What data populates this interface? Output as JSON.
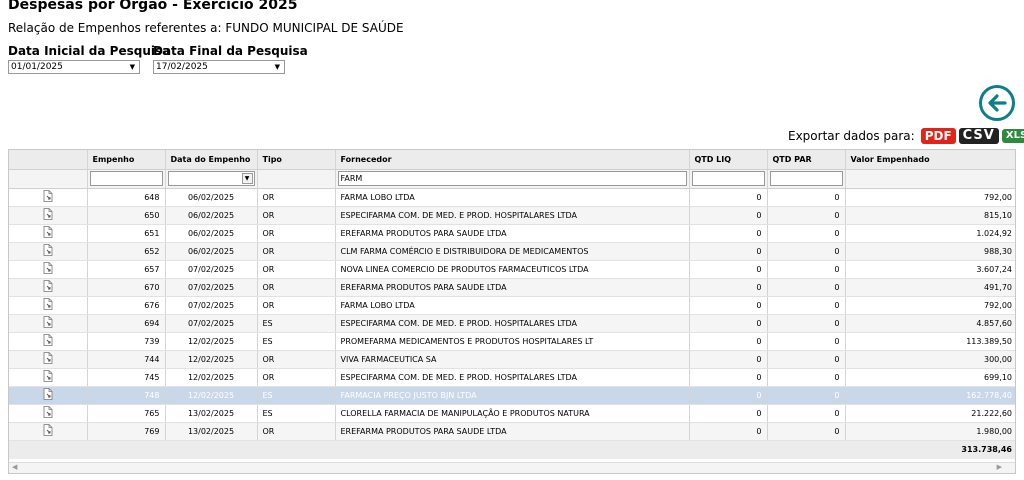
{
  "header": {
    "title": "Despesas por Orgão - Exercício 2025",
    "subtitle": "Relação de Empenhos referentes a: FUNDO MUNICIPAL DE SAÚDE"
  },
  "filters": {
    "start_label": "Data Inicial da Pesquisa",
    "start_value": "01/01/2025",
    "end_label": "Data Final da Pesquisa",
    "end_value": "17/02/2025"
  },
  "export": {
    "label": "Exportar dados para:",
    "pdf": "PDF",
    "csv": "CSV",
    "xls": "XLS"
  },
  "table": {
    "columns": [
      "",
      "Empenho",
      "Data do Empenho",
      "Tipo",
      "Fornecedor",
      "QTD LIQ",
      "QTD PAR",
      "Valor Empenhado"
    ],
    "filter_fornecedor": "FARM",
    "rows": [
      {
        "empenho": "648",
        "data": "06/02/2025",
        "tipo": "OR",
        "fornecedor": "FARMA LOBO LTDA",
        "qtd_liq": "0",
        "qtd_par": "0",
        "valor": "792,00"
      },
      {
        "empenho": "650",
        "data": "06/02/2025",
        "tipo": "OR",
        "fornecedor": "ESPECIFARMA COM. DE MED. E PROD. HOSPITALARES LTDA",
        "qtd_liq": "0",
        "qtd_par": "0",
        "valor": "815,10"
      },
      {
        "empenho": "651",
        "data": "06/02/2025",
        "tipo": "OR",
        "fornecedor": "EREFARMA PRODUTOS PARA SAUDE LTDA",
        "qtd_liq": "0",
        "qtd_par": "0",
        "valor": "1.024,92"
      },
      {
        "empenho": "652",
        "data": "06/02/2025",
        "tipo": "OR",
        "fornecedor": "CLM FARMA COMÉRCIO E DISTRIBUIDORA DE MEDICAMENTOS",
        "qtd_liq": "0",
        "qtd_par": "0",
        "valor": "988,30"
      },
      {
        "empenho": "657",
        "data": "07/02/2025",
        "tipo": "OR",
        "fornecedor": "NOVA LINEA COMERCIO DE PRODUTOS FARMACEUTICOS LTDA",
        "qtd_liq": "0",
        "qtd_par": "0",
        "valor": "3.607,24"
      },
      {
        "empenho": "670",
        "data": "07/02/2025",
        "tipo": "OR",
        "fornecedor": "EREFARMA PRODUTOS PARA SAUDE LTDA",
        "qtd_liq": "0",
        "qtd_par": "0",
        "valor": "491,70"
      },
      {
        "empenho": "676",
        "data": "07/02/2025",
        "tipo": "OR",
        "fornecedor": "FARMA LOBO LTDA",
        "qtd_liq": "0",
        "qtd_par": "0",
        "valor": "792,00"
      },
      {
        "empenho": "694",
        "data": "07/02/2025",
        "tipo": "ES",
        "fornecedor": "ESPECIFARMA COM. DE MED. E PROD. HOSPITALARES LTDA",
        "qtd_liq": "0",
        "qtd_par": "0",
        "valor": "4.857,60"
      },
      {
        "empenho": "739",
        "data": "12/02/2025",
        "tipo": "ES",
        "fornecedor": "PROMEFARMA MEDICAMENTOS E PRODUTOS HOSPITALARES LT",
        "qtd_liq": "0",
        "qtd_par": "0",
        "valor": "113.389,50"
      },
      {
        "empenho": "744",
        "data": "12/02/2025",
        "tipo": "OR",
        "fornecedor": "VIVA FARMACEUTICA SA",
        "qtd_liq": "0",
        "qtd_par": "0",
        "valor": "300,00"
      },
      {
        "empenho": "745",
        "data": "12/02/2025",
        "tipo": "OR",
        "fornecedor": "ESPECIFARMA COM. DE MED. E PROD. HOSPITALARES LTDA",
        "qtd_liq": "0",
        "qtd_par": "0",
        "valor": "699,10"
      },
      {
        "empenho": "748",
        "data": "12/02/2025",
        "tipo": "ES",
        "fornecedor": "FARMACIA PREÇO JUSTO BJN LTDA",
        "qtd_liq": "0",
        "qtd_par": "0",
        "valor": "162.778,40",
        "selected": true
      },
      {
        "empenho": "765",
        "data": "13/02/2025",
        "tipo": "ES",
        "fornecedor": "CLORELLA FARMACIA DE MANIPULAÇÃO E PRODUTOS NATURA",
        "qtd_liq": "0",
        "qtd_par": "0",
        "valor": "21.222,60"
      },
      {
        "empenho": "769",
        "data": "13/02/2025",
        "tipo": "OR",
        "fornecedor": "EREFARMA PRODUTOS PARA SAUDE LTDA",
        "qtd_liq": "0",
        "qtd_par": "0",
        "valor": "1.980,00"
      }
    ],
    "total": "313.738,46"
  }
}
